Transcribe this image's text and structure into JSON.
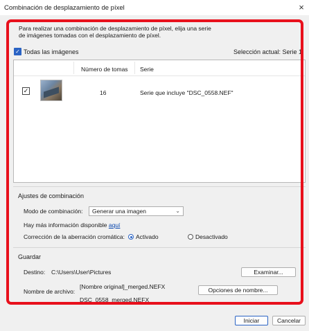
{
  "window": {
    "title": "Combinación de desplazamiento de píxel",
    "close_symbol": "×"
  },
  "intro": {
    "line1": "Para realizar una combinación de desplazamiento de píxel, elija una serie",
    "line2": "de imágenes tomadas con el desplazamiento de píxel."
  },
  "all_images": {
    "label": "Todas las imágenes",
    "checked": true
  },
  "current_selection": "Selección actual: Serie 1",
  "list": {
    "headers": {
      "shots": "Número de tomas",
      "series": "Serie"
    },
    "rows": [
      {
        "checked": true,
        "shots": "16",
        "series": "Serie que incluye \"DSC_0558.NEF\""
      }
    ]
  },
  "combination": {
    "title": "Ajustes de combinación",
    "mode_label": "Modo de combinación:",
    "mode_value": "Generar una imagen",
    "more_info_text": "Hay más información disponible",
    "more_info_link": "aquí",
    "aberration_label": "Corrección de la aberración cromática:",
    "option_on": "Activado",
    "option_off": "Desactivado",
    "selected": "Activado"
  },
  "save": {
    "title": "Guardar",
    "dest_label": "Destino:",
    "dest_value": "C:\\Users\\User\\Pictures",
    "browse_label": "Examinar...",
    "filename_label": "Nombre de archivo:",
    "filename_pattern": "[Nombre original]_merged.NEFX",
    "filename_example": "DSC_0558_merged.NEFX",
    "name_options_label": "Opciones de nombre..."
  },
  "footer": {
    "start_label": "Iniciar",
    "cancel_label": "Cancelar"
  },
  "colors": {
    "highlight": "#e8101c",
    "accent": "#2a63c4",
    "link": "#0645ad"
  }
}
